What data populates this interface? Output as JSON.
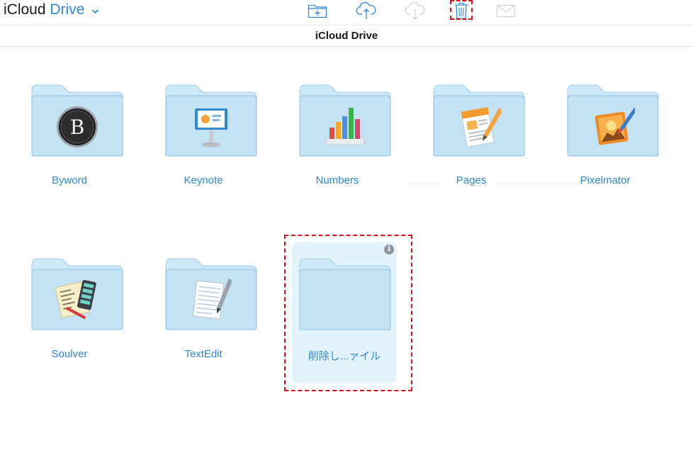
{
  "header": {
    "title_part1": "iCloud",
    "title_part2": "Drive",
    "toolbar": [
      {
        "icon": "new-folder-icon",
        "enabled": true
      },
      {
        "icon": "upload-icon",
        "enabled": true
      },
      {
        "icon": "download-icon",
        "enabled": false
      },
      {
        "icon": "trash-icon",
        "enabled": true
      },
      {
        "icon": "mail-icon",
        "enabled": false
      }
    ]
  },
  "subheader": {
    "title": "iCloud Drive"
  },
  "folders": [
    {
      "label": "Byword",
      "app_icon": "byword-icon"
    },
    {
      "label": "Keynote",
      "app_icon": "keynote-icon"
    },
    {
      "label": "Numbers",
      "app_icon": "numbers-icon"
    },
    {
      "label": "Pages",
      "app_icon": "pages-icon"
    },
    {
      "label": "Pixelmator",
      "app_icon": "pixelmator-icon"
    },
    {
      "label": "Soulver",
      "app_icon": "soulver-icon"
    },
    {
      "label": "TextEdit",
      "app_icon": "textedit-icon"
    },
    {
      "label": "削除し...ァイル",
      "app_icon": null,
      "selected": true,
      "info_glyph": "i"
    }
  ],
  "colors": {
    "accent": "#2f88d6",
    "folder_fill": "#c8e6f6",
    "folder_stroke": "#8cc3e6",
    "highlight": "#e0101a",
    "selected_bg": "#e3f3fc"
  }
}
